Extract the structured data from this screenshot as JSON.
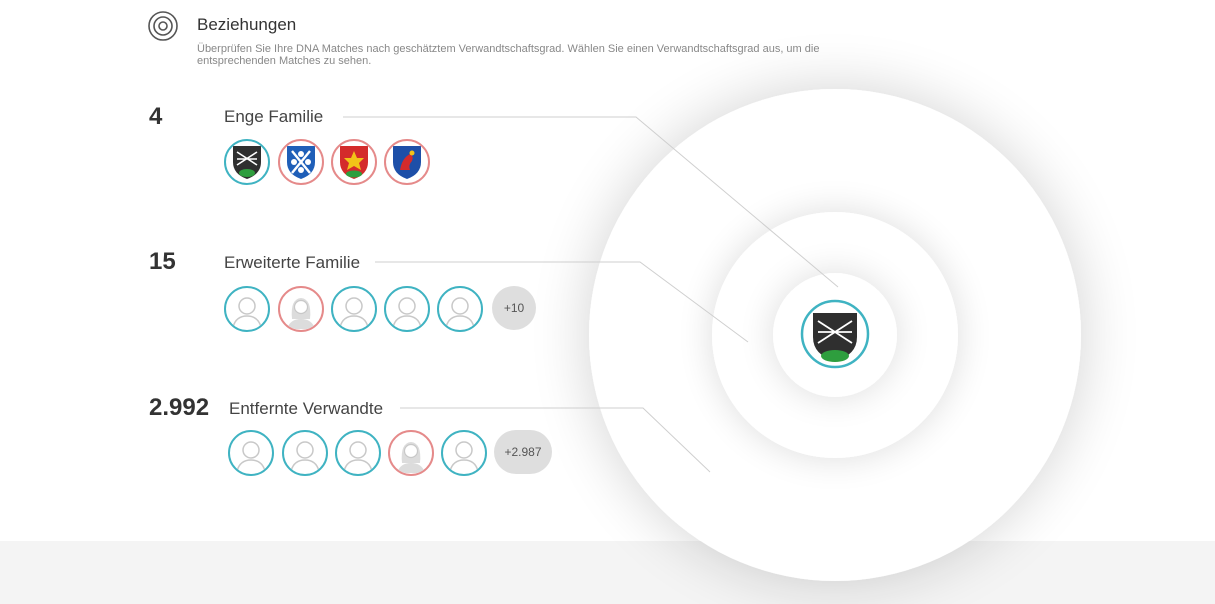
{
  "header": {
    "icon": "concentric-circles-icon",
    "title": "Beziehungen",
    "description": "Überprüfen Sie Ihre DNA Matches nach geschätztem Verwandtschaftsgrad. Wählen Sie einen Verwandtschaftsgrad aus, um die entsprechenden Matches zu sehen."
  },
  "groups": [
    {
      "count": "4",
      "label": "Enge Familie",
      "avatars": [
        "coat-of-arms-dark",
        "coat-of-arms-blue",
        "coat-of-arms-red",
        "coat-of-arms-dragon"
      ],
      "more": ""
    },
    {
      "count": "15",
      "label": "Erweiterte Familie",
      "avatars": [
        "male",
        "female",
        "male",
        "male",
        "male"
      ],
      "more": "+10"
    },
    {
      "count": "2.992",
      "label": "Entfernte Verwandte",
      "avatars": [
        "male",
        "male",
        "male",
        "female",
        "male"
      ],
      "more": "+2.987"
    }
  ],
  "center": {
    "avatar": "coat-of-arms-dark"
  },
  "colors": {
    "male": "#3fb3c2",
    "female": "#e58a8a",
    "more_bg": "#dedede"
  }
}
